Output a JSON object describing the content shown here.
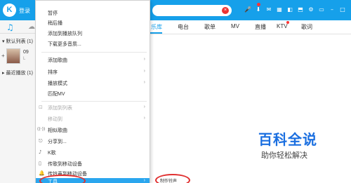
{
  "header": {
    "logo_text": "K",
    "login": "登录",
    "search_clear": "×",
    "icons": [
      "mic-icon",
      "download-icon",
      "mail-icon",
      "skin-icon",
      "gamepad-icon",
      "shirt-icon",
      "settings-icon",
      "mini-mode-icon",
      "minimize-icon",
      "maximize-icon",
      "close-icon"
    ],
    "icon_glyphs": [
      "🎤",
      "⬇",
      "✉",
      "▦",
      "◧",
      "⬒",
      "⚙",
      "▭",
      "–",
      "□",
      "×"
    ]
  },
  "sidebar": {
    "music_icon": "♫",
    "cloud_icon": "☁",
    "default_list": "▾ 默认列表 (1)",
    "plus": "+",
    "song_num": "09",
    "song_sub": "L",
    "recent": "▸ 最近播放 (1)"
  },
  "nav": {
    "tabs": [
      {
        "label": "乐库",
        "active": true
      },
      {
        "label": "电台",
        "active": false
      },
      {
        "label": "歌单",
        "active": false
      },
      {
        "label": "MV",
        "active": false
      },
      {
        "label": "直播",
        "active": false
      },
      {
        "label": "KTV",
        "active": false
      },
      {
        "label": "歌词",
        "active": false
      }
    ]
  },
  "menu": {
    "items": [
      {
        "label": "暂停",
        "icon": "",
        "arrow": "",
        "disabled": false
      },
      {
        "label": "稍后播",
        "icon": "",
        "arrow": "",
        "disabled": false
      },
      {
        "label": "添加到播放队列",
        "icon": "",
        "arrow": "",
        "disabled": false
      },
      {
        "label": "下载更多音质...",
        "icon": "",
        "arrow": "",
        "disabled": false
      },
      {
        "label": "添加歌曲",
        "icon": "",
        "arrow": "›",
        "disabled": false
      },
      {
        "label": "排序",
        "icon": "",
        "arrow": "›",
        "disabled": false
      },
      {
        "label": "播放模式",
        "icon": "",
        "arrow": "›",
        "disabled": false
      },
      {
        "label": "匹配MV",
        "icon": "",
        "arrow": "",
        "disabled": false
      },
      {
        "label": "添加到列表",
        "icon": "⊡",
        "arrow": "›",
        "disabled": true
      },
      {
        "label": "移动到",
        "icon": "",
        "arrow": "›",
        "disabled": true
      },
      {
        "label": "相似歌曲",
        "icon": "((·))",
        "arrow": "",
        "disabled": false
      },
      {
        "label": "分享到...",
        "icon": "⎋",
        "arrow": "",
        "disabled": false
      },
      {
        "label": "K歌",
        "icon": "♪",
        "arrow": "",
        "disabled": false
      },
      {
        "label": "传歌到移动设备",
        "icon": "▯",
        "arrow": "",
        "disabled": false
      },
      {
        "label": "传铃声到移动设备",
        "icon": "🔔",
        "arrow": "",
        "disabled": false
      },
      {
        "label": "工具",
        "icon": "",
        "arrow": "›",
        "disabled": false
      }
    ],
    "submenu_label": "制作铃声"
  },
  "watermark": {
    "title": "百科全说",
    "subtitle": "助你轻松解决"
  },
  "colors": {
    "brand": "#16a0ea",
    "highlight": "#2aa6ee",
    "annotation": "#e03030"
  }
}
